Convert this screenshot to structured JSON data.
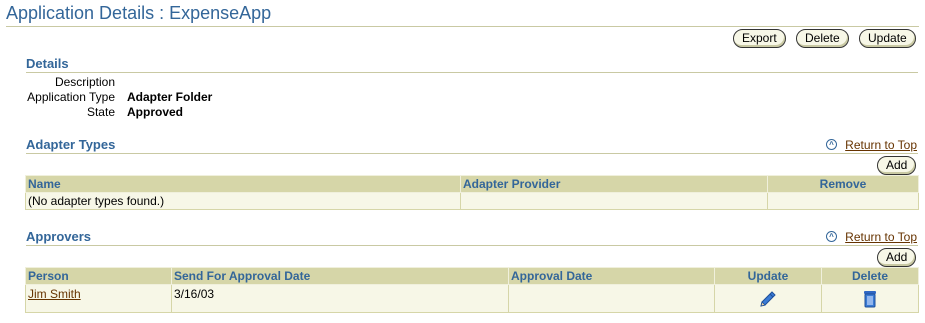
{
  "page": {
    "title": "Application Details : ExpenseApp"
  },
  "actions": {
    "export": "Export",
    "delete": "Delete",
    "update": "Update"
  },
  "details": {
    "title": "Details",
    "fields": [
      {
        "label": "Description",
        "value": ""
      },
      {
        "label": "Application Type",
        "value": "Adapter Folder"
      },
      {
        "label": "State",
        "value": "Approved"
      }
    ]
  },
  "adapter_types": {
    "title": "Adapter Types",
    "return_to_top": "Return to Top",
    "add_label": "Add",
    "columns": [
      "Name",
      "Adapter Provider",
      "Remove"
    ],
    "empty_message": "(No adapter types found.)"
  },
  "approvers": {
    "title": "Approvers",
    "return_to_top": "Return to Top",
    "add_label": "Add",
    "columns": [
      "Person",
      "Send For Approval Date",
      "Approval Date",
      "Update",
      "Delete"
    ],
    "rows": [
      {
        "person": "Jim Smith",
        "send_date": "3/16/03",
        "approval_date": "",
        "update_icon": "pencil-icon",
        "delete_icon": "trash-icon"
      }
    ]
  },
  "colors": {
    "accent": "#336699",
    "link": "#663300",
    "header_bg": "#d6d6a8",
    "row_bg": "#f7f7e7"
  }
}
